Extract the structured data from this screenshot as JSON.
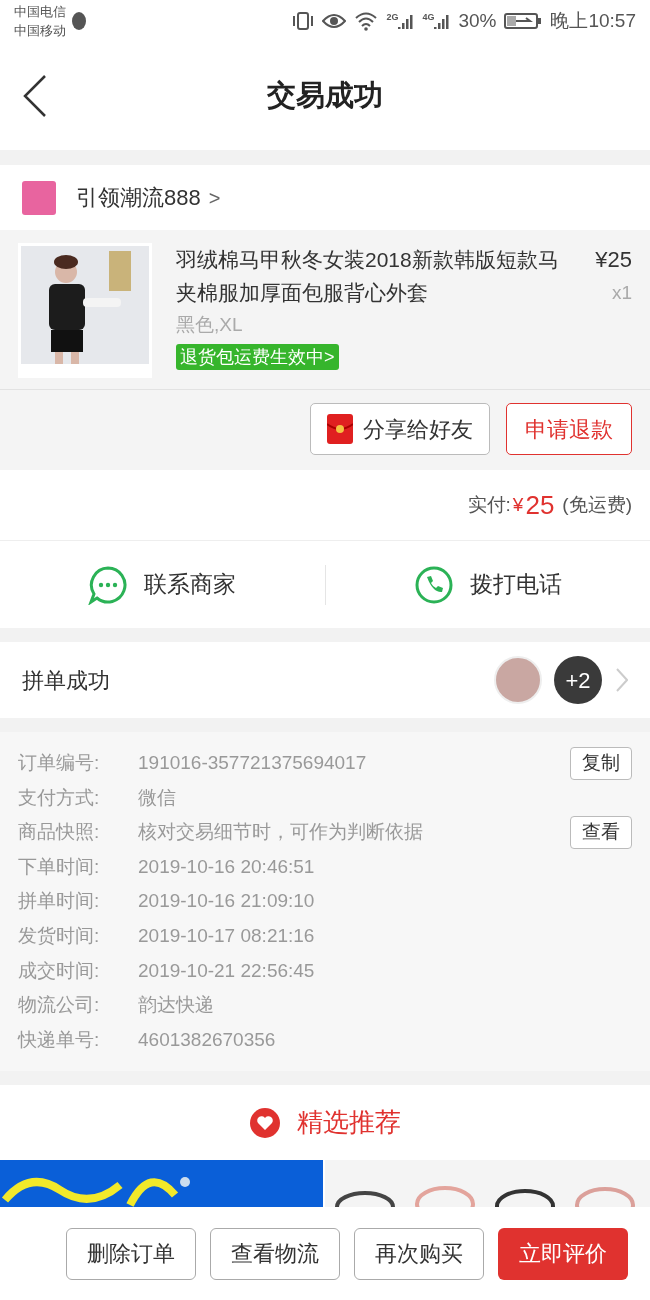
{
  "status_bar": {
    "carriers": [
      "中国电信",
      "中国移动"
    ],
    "network_1": "2G",
    "network_2": "4G",
    "battery": "30%",
    "time": "晚上10:57"
  },
  "header": {
    "title": "交易成功"
  },
  "shop": {
    "name": "引领潮流888",
    "arrow": ">"
  },
  "product": {
    "title": "羽绒棉马甲秋冬女装2018新款韩版短款马夹棉服加厚面包服背心外套",
    "price": "¥25",
    "quantity": "x1",
    "spec": "黑色,XL",
    "badge": "退货包运费生效中>"
  },
  "product_actions": [
    {
      "label": "分享给好友",
      "kind": "share"
    },
    {
      "label": "申请退款",
      "kind": "outline"
    }
  ],
  "payment": {
    "label": "实付:",
    "currency": "¥",
    "amount": "25",
    "note": "(免运费)"
  },
  "contact": [
    {
      "label": "联系商家",
      "kind": "chat"
    },
    {
      "label": "拨打电话",
      "kind": "phone"
    }
  ],
  "group": {
    "label": "拼单成功",
    "more": "+2"
  },
  "order_info": [
    {
      "label": "订单编号:",
      "value": "191016-357721375694017",
      "button": "复制"
    },
    {
      "label": "支付方式:",
      "value": "微信"
    },
    {
      "label": "商品快照:",
      "value": "核对交易细节时，可作为判断依据",
      "button": "查看"
    },
    {
      "label": "下单时间:",
      "value": "2019-10-16 20:46:51"
    },
    {
      "label": "拼单时间:",
      "value": "2019-10-16 21:09:10"
    },
    {
      "label": "发货时间:",
      "value": "2019-10-17 08:21:16"
    },
    {
      "label": "成交时间:",
      "value": "2019-10-21 22:56:45"
    },
    {
      "label": "物流公司:",
      "value": "韵达快递"
    },
    {
      "label": "快递单号:",
      "value": "4601382670356"
    }
  ],
  "recommend": {
    "title": "精选推荐"
  },
  "bottom_actions": [
    {
      "label": "删除订单",
      "primary": false
    },
    {
      "label": "查看物流",
      "primary": false
    },
    {
      "label": "再次购买",
      "primary": false
    },
    {
      "label": "立即评价",
      "primary": true
    }
  ]
}
